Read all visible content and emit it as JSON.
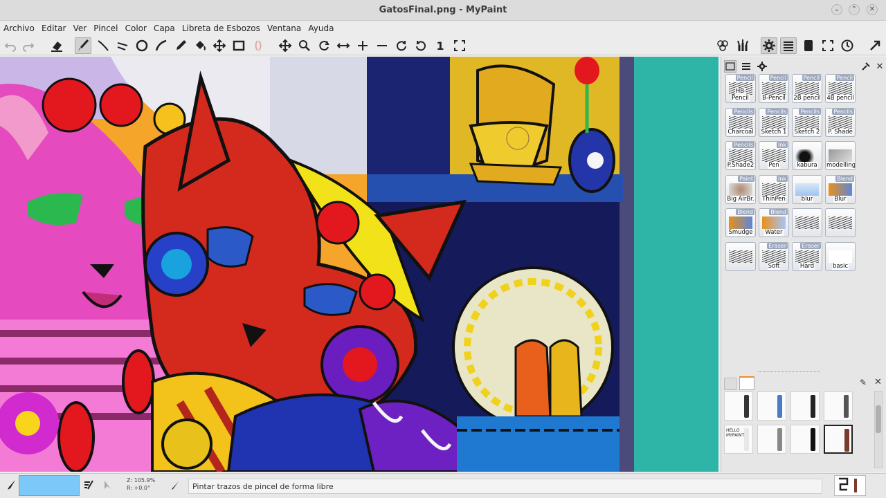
{
  "window": {
    "title": "GatosFinal.png - MyPaint",
    "controls": [
      "minimize",
      "maximize",
      "close"
    ]
  },
  "menubar": {
    "items": [
      "Archivo",
      "Editar",
      "Ver",
      "Pincel",
      "Color",
      "Capa",
      "Libreta de Esbozos",
      "Ventana",
      "Ayuda"
    ]
  },
  "toolbar": {
    "left_tools": [
      "undo-icon",
      "redo-icon",
      "eraser-icon",
      "freehand-brush-icon",
      "inking-icon",
      "line-icon",
      "ellipse-icon",
      "pen-icon",
      "color-picker-icon",
      "fill-icon",
      "move-icon",
      "frame-icon",
      "symmetry-icon"
    ],
    "view_tools": [
      "pan-icon",
      "zoom-icon",
      "rotate-icon",
      "flip-icon",
      "zoom-in-icon",
      "zoom-out-icon",
      "rotate-cw-icon",
      "rotate-ccw-icon",
      "reset-view-icon",
      "fit-view-icon"
    ],
    "view_reset_label": "1",
    "right_tools": [
      "color-palette-icon",
      "brush-group-icon",
      "settings-icon",
      "layers-menu-icon",
      "scratchpad-icon",
      "fullscreen-icon",
      "history-icon",
      "expand-icon"
    ]
  },
  "canvas": {
    "background_color": "#2fb5a8",
    "cursor": "brush-circle-cursor"
  },
  "brush_panel": {
    "tabs": [
      "brush-list-icon",
      "list-icon",
      "settings-icon"
    ],
    "rows": [
      [
        {
          "tag": "Pencil",
          "label": "HB-Pencil"
        },
        {
          "tag": "Pencil",
          "label": "B-Pencil"
        },
        {
          "tag": "Pencil",
          "label": "2B pencil"
        },
        {
          "tag": "Pencil",
          "label": "4B pencil"
        }
      ],
      [
        {
          "tag": "Pencils",
          "label": "Charcoal"
        },
        {
          "tag": "Pencils",
          "label": "Sketch 1"
        },
        {
          "tag": "Pencils",
          "label": "Sketch 2"
        },
        {
          "tag": "Pencils",
          "label": "P. Shade"
        }
      ],
      [
        {
          "tag": "Pencils",
          "label": "P.Shade2"
        },
        {
          "tag": "Ink",
          "label": "Pen"
        },
        {
          "tag": "",
          "label": "kabura"
        },
        {
          "tag": "",
          "label": "modelling"
        }
      ],
      [
        {
          "tag": "Paint",
          "label": "Big AirBr."
        },
        {
          "tag": "Ink",
          "label": "ThinPen"
        },
        {
          "tag": "",
          "label": "blur"
        },
        {
          "tag": "Blend",
          "label": "Blur"
        }
      ],
      [
        {
          "tag": "Blend",
          "label": "Smudge"
        },
        {
          "tag": "Blend",
          "label": "Water"
        },
        {
          "tag": "",
          "label": ""
        },
        {
          "tag": "",
          "label": ""
        }
      ],
      [
        {
          "tag": "",
          "label": ""
        },
        {
          "tag": "Eraser",
          "label": "Soft"
        },
        {
          "tag": "Eraser",
          "label": "Hard"
        },
        {
          "tag": "",
          "label": "basic"
        }
      ]
    ]
  },
  "brush_group_panel": {
    "tabs": [
      "brush-tab-icon",
      "group-tab-icon"
    ],
    "chips": [
      [
        "marker",
        "pencil",
        "hatch",
        "technical-pen"
      ],
      [
        "hello-mypaint",
        "swirl-pencil",
        "ink-pen",
        "selected-brush"
      ]
    ],
    "chip_text": "HELLO MYPAINT"
  },
  "statusbar": {
    "color_swatch": "#7cc8f8",
    "zoom": "Z: 105.9%",
    "rotation": "R: +0.0°",
    "message": "Pintar trazos de pincel de forma libre"
  }
}
